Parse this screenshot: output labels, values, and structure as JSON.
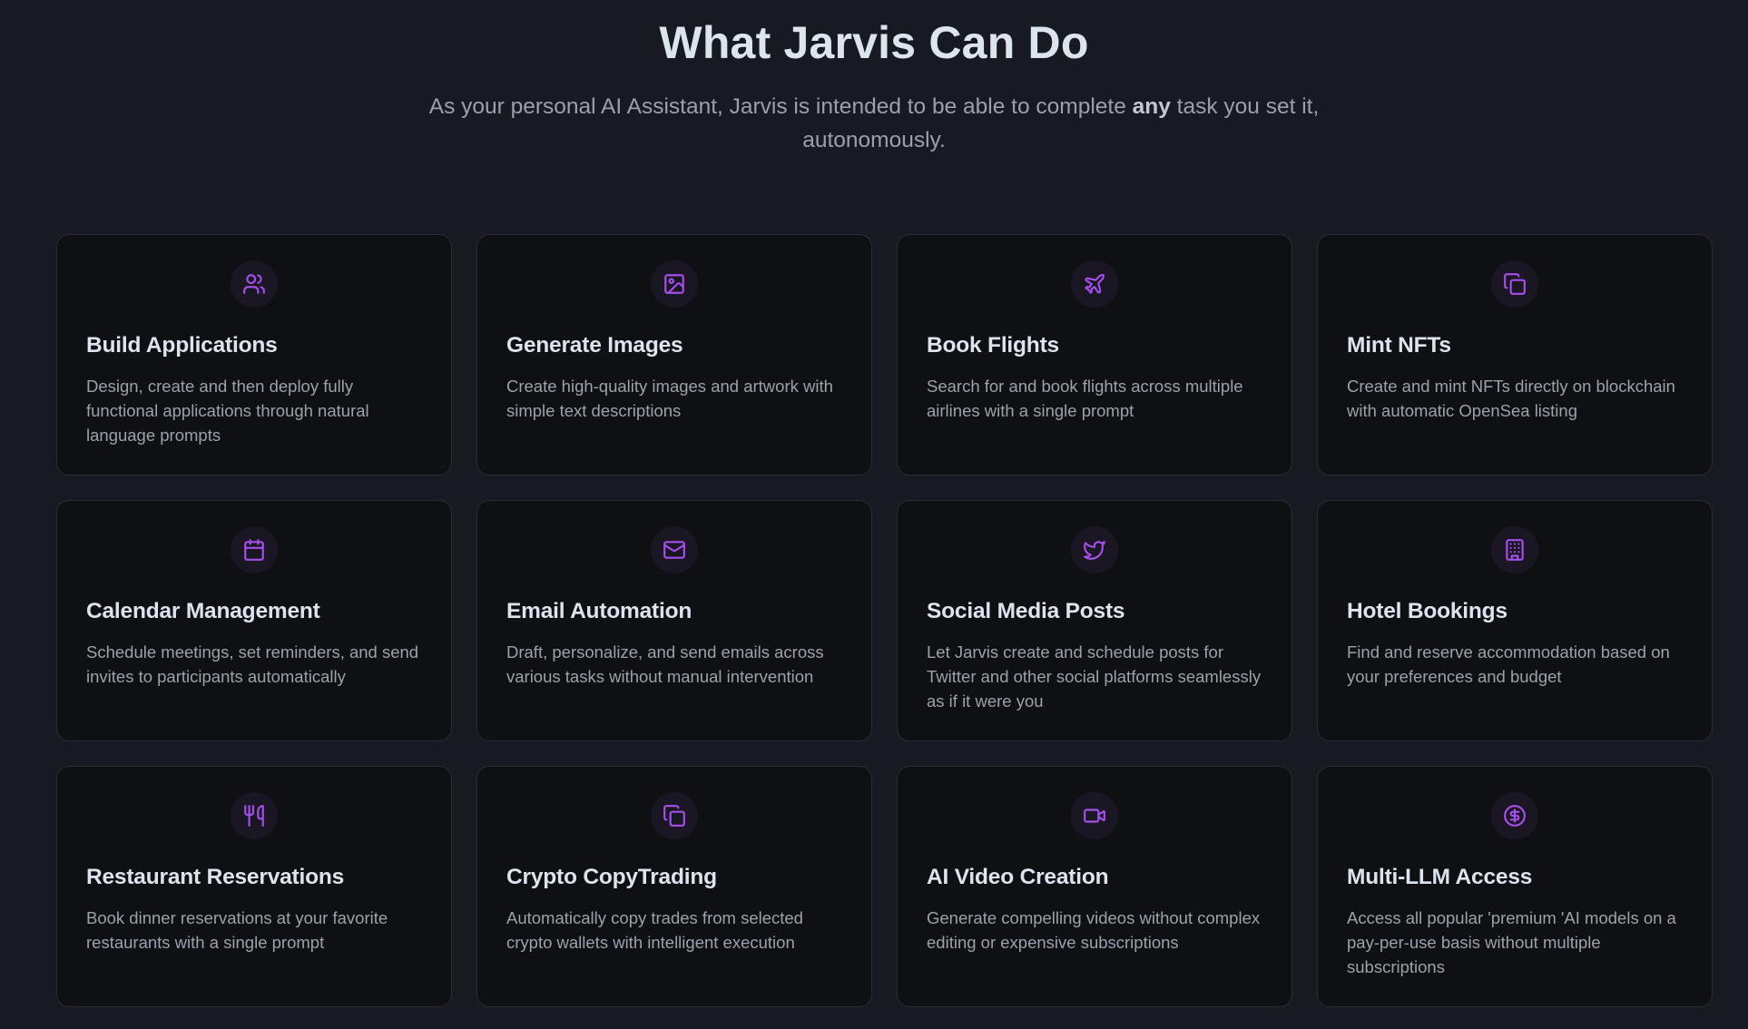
{
  "header": {
    "title": "What Jarvis Can Do",
    "subtitle_before": "As your personal AI Assistant, Jarvis is intended to be able to complete ",
    "subtitle_bold": "any",
    "subtitle_after": " task you set it, autonomously."
  },
  "accent_color": "#a34fe8",
  "cards": [
    {
      "icon": "users-icon",
      "title": "Build Applications",
      "desc": "Design, create and then deploy fully functional applications through natural language prompts"
    },
    {
      "icon": "image-icon",
      "title": "Generate Images",
      "desc": "Create high-quality images and artwork with simple text descriptions"
    },
    {
      "icon": "plane-icon",
      "title": "Book Flights",
      "desc": "Search for and book flights across multiple airlines with a single prompt"
    },
    {
      "icon": "copy-icon",
      "title": "Mint NFTs",
      "desc": "Create and mint NFTs directly on blockchain with automatic OpenSea listing"
    },
    {
      "icon": "calendar-icon",
      "title": "Calendar Management",
      "desc": "Schedule meetings, set reminders, and send invites to participants automatically"
    },
    {
      "icon": "mail-icon",
      "title": "Email Automation",
      "desc": "Draft, personalize, and send emails across various tasks without manual intervention"
    },
    {
      "icon": "twitter-icon",
      "title": "Social Media Posts",
      "desc": "Let Jarvis create and schedule posts for Twitter and other social platforms seamlessly as if it were you"
    },
    {
      "icon": "building-icon",
      "title": "Hotel Bookings",
      "desc": "Find and reserve accommodation based on your preferences and budget"
    },
    {
      "icon": "utensils-icon",
      "title": "Restaurant Reservations",
      "desc": "Book dinner reservations at your favorite restaurants with a single prompt"
    },
    {
      "icon": "copy-icon",
      "title": "Crypto CopyTrading",
      "desc": "Automatically copy trades from selected crypto wallets with intelligent execution"
    },
    {
      "icon": "video-icon",
      "title": "AI Video Creation",
      "desc": "Generate compelling videos without complex editing or expensive subscriptions"
    },
    {
      "icon": "dollar-circle-icon",
      "title": "Multi-LLM Access",
      "desc": "Access all popular 'premium 'AI models on a pay-per-use basis without multiple subscriptions"
    }
  ]
}
